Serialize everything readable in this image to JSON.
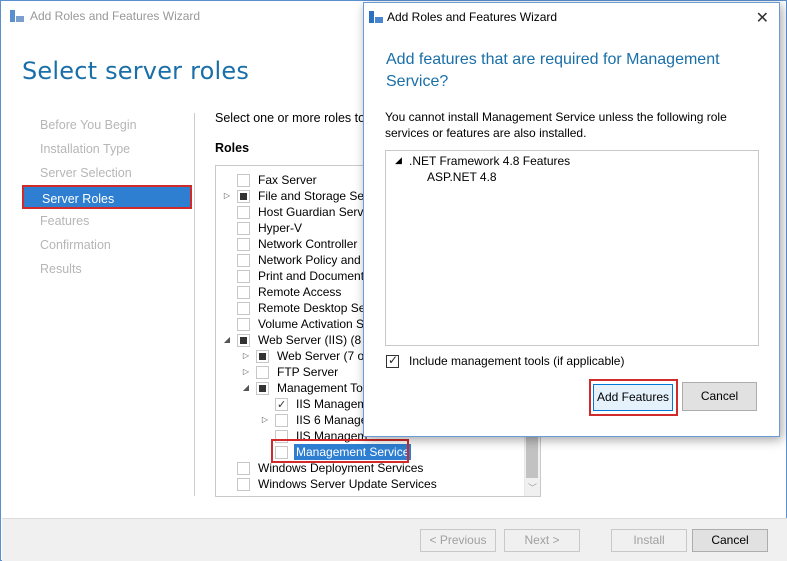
{
  "main_window": {
    "title": "Add Roles and Features Wizard",
    "heading": "Select server roles",
    "nav": [
      {
        "label": "Before You Begin",
        "selected": false
      },
      {
        "label": "Installation Type",
        "selected": false
      },
      {
        "label": "Server Selection",
        "selected": false
      },
      {
        "label": "Server Roles",
        "selected": true
      },
      {
        "label": "Features",
        "selected": false
      },
      {
        "label": "Confirmation",
        "selected": false
      },
      {
        "label": "Results",
        "selected": false
      }
    ],
    "intro": "Select one or more roles to i",
    "roles_header": "Roles",
    "roles": [
      {
        "label": "Fax Server"
      },
      {
        "label": "File and Storage Ser"
      },
      {
        "label": "Host Guardian Servic"
      },
      {
        "label": "Hyper-V"
      },
      {
        "label": "Network Controller"
      },
      {
        "label": "Network Policy and "
      },
      {
        "label": "Print and Document"
      },
      {
        "label": "Remote Access"
      },
      {
        "label": "Remote Desktop Ser"
      },
      {
        "label": "Volume Activation S"
      },
      {
        "label": "Web Server (IIS) (8 o"
      },
      {
        "label": "Web Server (7 of"
      },
      {
        "label": "FTP Server"
      },
      {
        "label": "Management To"
      },
      {
        "label": "IIS Managem"
      },
      {
        "label": "IIS 6 Manage"
      },
      {
        "label": "IIS Managem"
      },
      {
        "label": "Management Service"
      },
      {
        "label": "Windows Deployment Services"
      },
      {
        "label": "Windows Server Update Services"
      }
    ],
    "buttons": {
      "previous": "< Previous",
      "next": "Next >",
      "install": "Install",
      "cancel": "Cancel"
    }
  },
  "dialog": {
    "title": "Add Roles and Features Wizard",
    "close": "✕",
    "heading": "Add features that are required for Management Service?",
    "description": "You cannot install Management Service unless the following role services or features are also installed.",
    "features": [
      {
        "label": ".NET Framework 4.8 Features",
        "expander": "◢"
      },
      {
        "label": "ASP.NET 4.8"
      }
    ],
    "include_tools_label": "Include management tools (if applicable)",
    "include_tools_checked": true,
    "add_button": "Add Features",
    "cancel_button": "Cancel"
  },
  "colors": {
    "accent": "#1a6fa8",
    "selection": "#2e7fd1",
    "highlight_border": "#d12a2a"
  }
}
